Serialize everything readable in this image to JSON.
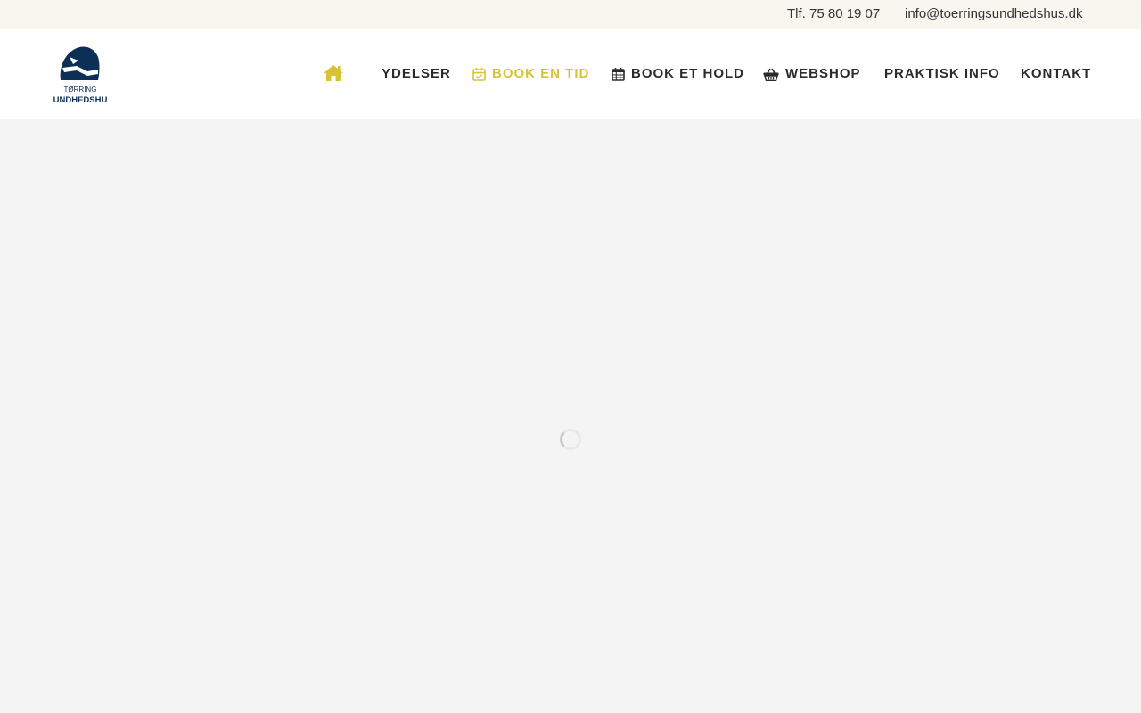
{
  "topbar": {
    "phone": "Tlf. 75 80 19 07",
    "email": "info@toerringsundhedshus.dk"
  },
  "logo": {
    "line1": "TØRRING",
    "line2": "SUNDHEDSHUS",
    "color": "#0d2f55"
  },
  "nav": {
    "home_icon": "home-icon",
    "items": [
      {
        "label": "YDELSER",
        "icon": ""
      },
      {
        "label": "BOOK EN TID",
        "icon": "calendar-check-icon",
        "active": true
      },
      {
        "label": "BOOK ET HOLD",
        "icon": "calendar-icon"
      },
      {
        "label": "WEBSHOP",
        "icon": "basket-icon"
      },
      {
        "label": "PRAKTISK INFO",
        "icon": ""
      },
      {
        "label": "KONTAKT",
        "icon": ""
      }
    ]
  },
  "colors": {
    "accent": "#d8c334",
    "topbar_bg": "#f9f6ef",
    "content_bg": "#f4f4f4",
    "nav_text": "#2b2b2b"
  },
  "content": {
    "loading_icon": "loading-spinner-icon"
  }
}
